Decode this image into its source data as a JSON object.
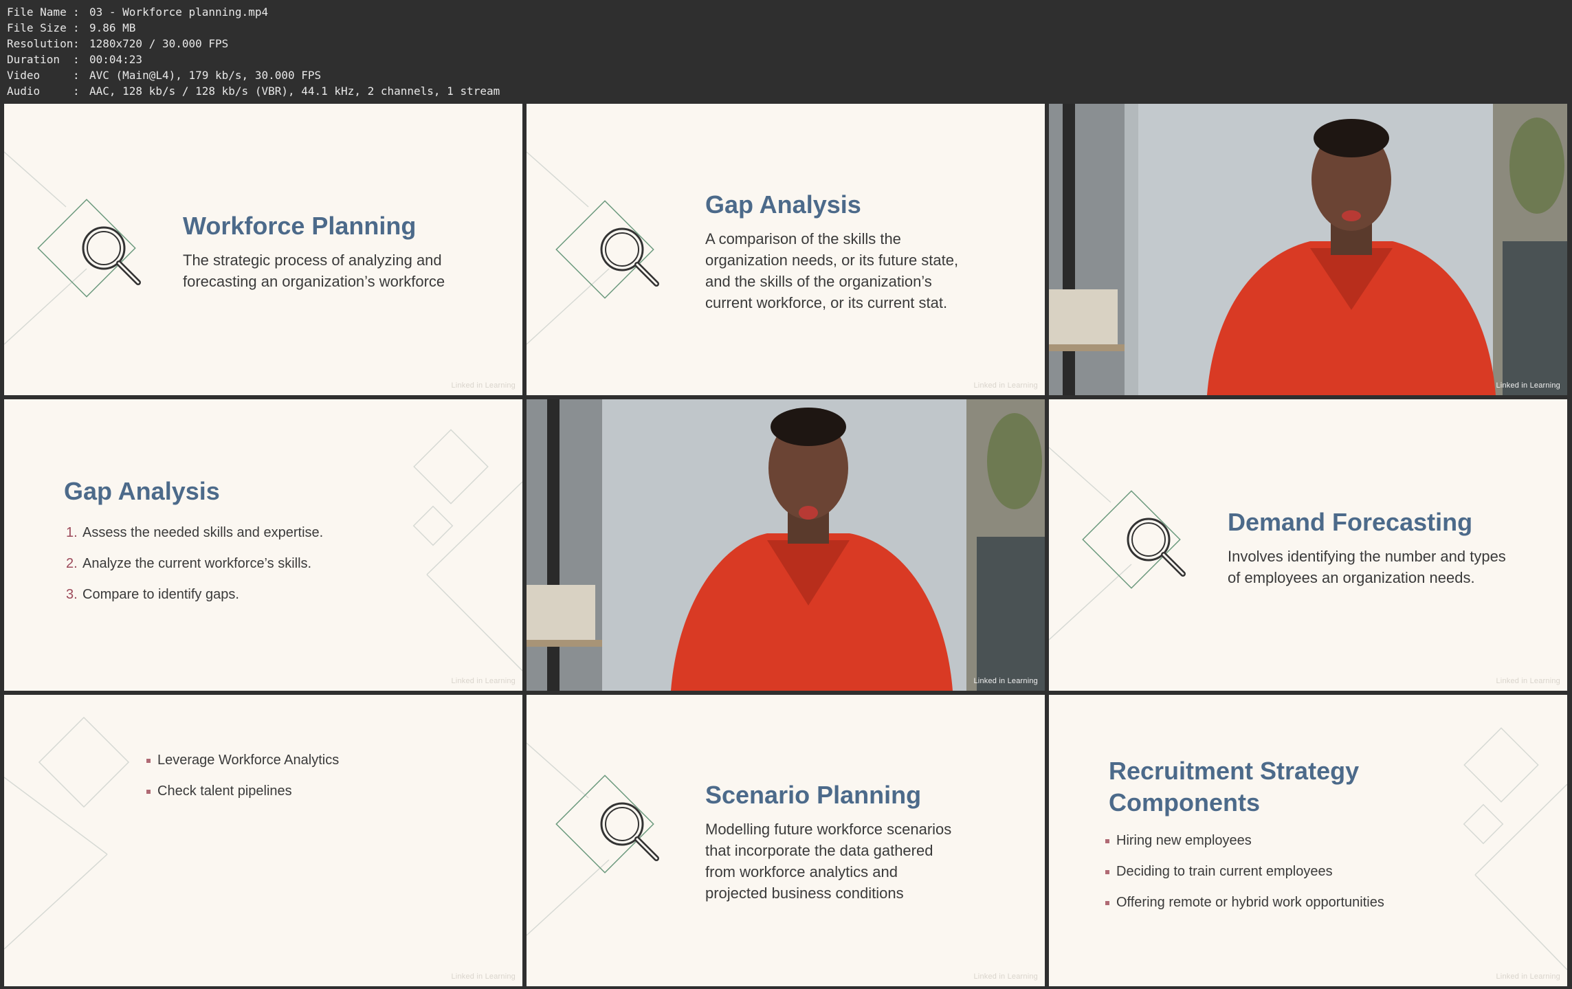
{
  "metadata": {
    "rows": [
      {
        "key": "File Name",
        "value": "03 - Workforce planning.mp4"
      },
      {
        "key": "File Size",
        "value": "9.86 MB"
      },
      {
        "key": "Resolution",
        "value": "1280x720 / 30.000 FPS"
      },
      {
        "key": "Duration",
        "value": "00:04:23"
      },
      {
        "key": "Video",
        "value": "AVC (Main@L4), 179 kb/s, 30.000 FPS"
      },
      {
        "key": "Audio",
        "value": "AAC, 128 kb/s / 128 kb/s (VBR), 44.1 kHz, 2 channels, 1 stream"
      }
    ]
  },
  "watermark": "Linked in Learning",
  "frames": {
    "f1": {
      "title": "Workforce Planning",
      "body": [
        "The strategic process of analyzing and",
        "forecasting an organization’s workforce"
      ]
    },
    "f2": {
      "title": "Gap Analysis",
      "body": [
        "A comparison of the skills the",
        "organization needs, or its future state,",
        "and the skills of the organization’s",
        "current workforce, or its current stat."
      ]
    },
    "f4": {
      "title": "Gap Analysis",
      "items": [
        {
          "num": "1.",
          "text": "Assess the needed skills and expertise."
        },
        {
          "num": "2.",
          "text": "Analyze the current workforce’s skills."
        },
        {
          "num": "3.",
          "text": "Compare to identify gaps."
        }
      ]
    },
    "f6": {
      "title": "Demand Forecasting",
      "body": [
        "Involves identifying the number and types",
        "of employees an organization needs."
      ]
    },
    "f7": {
      "items": [
        "Leverage Workforce Analytics",
        "Check talent pipelines"
      ]
    },
    "f8": {
      "title": "Scenario Planning",
      "body": [
        "Modelling future workforce scenarios",
        "that incorporate the data gathered",
        "from workforce analytics and",
        "projected business conditions"
      ]
    },
    "f9": {
      "title": [
        "Recruitment Strategy",
        "Components"
      ],
      "items": [
        "Hiring new employees",
        "Deciding to train current employees",
        "Offering remote or hybrid work opportunities"
      ]
    }
  },
  "colors": {
    "slide_bg": "#fbf7f1",
    "title": "#4c6a8a",
    "accent": "#9c4a5a",
    "shirt": "#d93a24"
  }
}
